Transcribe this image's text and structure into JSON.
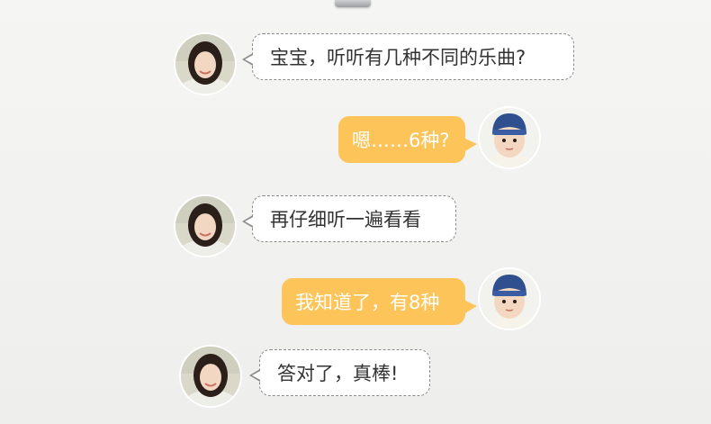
{
  "colors": {
    "right_bubble": "#fcc459",
    "left_bubble_border": "#8a8a8a",
    "left_text": "#333333",
    "right_text": "#ffffff"
  },
  "messages": [
    {
      "sender": "mother",
      "avatar": "mother-avatar",
      "text": "宝宝，听听有几种不同的乐曲?"
    },
    {
      "sender": "child",
      "avatar": "child-avatar",
      "text": "嗯……6种?"
    },
    {
      "sender": "mother",
      "avatar": "mother-avatar",
      "text": "再仔细听一遍看看"
    },
    {
      "sender": "child",
      "avatar": "child-avatar",
      "text": "我知道了，有8种"
    },
    {
      "sender": "mother",
      "avatar": "mother-avatar",
      "text": "答对了，真棒!"
    }
  ]
}
